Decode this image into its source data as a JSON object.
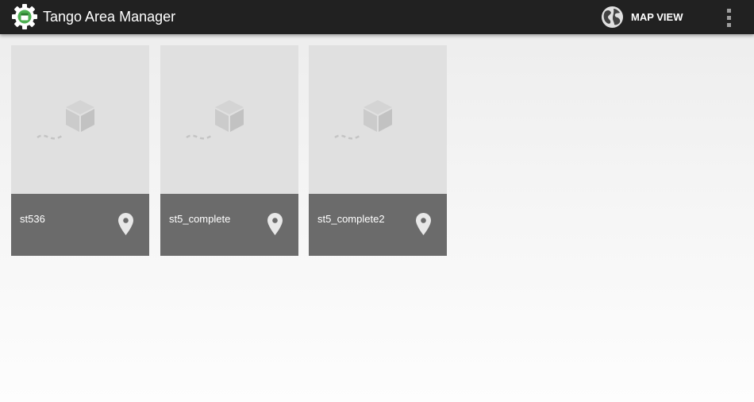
{
  "app_bar": {
    "title": "Tango Area Manager",
    "app_icon": "gear-icon",
    "actions": {
      "map_view_label": "MAP VIEW",
      "map_view_icon": "globe-icon",
      "overflow_icon": "more-vert-icon"
    },
    "background_color": "#212121"
  },
  "areas": [
    {
      "name": "st536",
      "thumbnail_icon": "cube-path-icon",
      "location_icon": "map-pin-icon"
    },
    {
      "name": "st5_complete",
      "thumbnail_icon": "cube-path-icon",
      "location_icon": "map-pin-icon"
    },
    {
      "name": "st5_complete2",
      "thumbnail_icon": "cube-path-icon",
      "location_icon": "map-pin-icon"
    }
  ],
  "colors": {
    "app_icon_accent": "#4caf50",
    "card_thumbnail": "#e0e0e0",
    "card_footer": "#6b6b6b"
  }
}
